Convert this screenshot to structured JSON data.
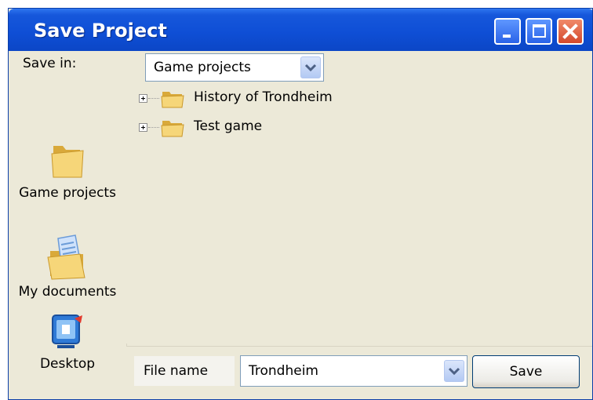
{
  "window": {
    "title": "Save Project",
    "controls": {
      "minimize_icon": "minimize-icon",
      "maximize_icon": "maximize-icon",
      "close_icon": "close-icon"
    }
  },
  "save_in": {
    "label": "Save in:",
    "selected": "Game projects",
    "dropdown_icon": "chevron-down-icon"
  },
  "places": [
    {
      "label": "Game projects",
      "icon": "folder-icon"
    },
    {
      "label": "My documents",
      "icon": "documents-folder-icon"
    },
    {
      "label": "Desktop",
      "icon": "desktop-icon"
    }
  ],
  "tree": [
    {
      "label": "History of Trondheim",
      "icon": "folder-icon",
      "expander": "expand-plus-icon"
    },
    {
      "label": "Test game",
      "icon": "folder-icon",
      "expander": "expand-plus-icon"
    }
  ],
  "file_name": {
    "label": "File name",
    "value": "Trondheim",
    "dropdown_icon": "chevron-down-icon"
  },
  "actions": {
    "save_label": "Save"
  },
  "colors": {
    "titlebar": "#0b46c6",
    "window_bg": "#ece9d8",
    "close_button": "#d4482c",
    "folder": "#f3d27a"
  }
}
